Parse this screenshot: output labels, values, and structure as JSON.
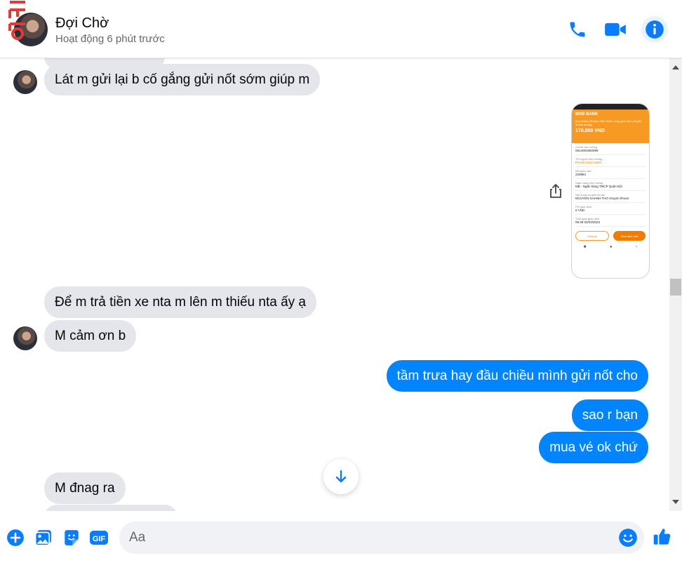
{
  "header": {
    "name": "Đợi Chờ",
    "status": "Hoạt động 6 phút trước",
    "corner_mark_text": "INFO"
  },
  "messages": [
    {
      "dir": "in",
      "text": "Lát m gửi lại b cố gắng gửi nốt sớm giúp m"
    },
    {
      "dir": "in",
      "text": "Để m trả tiền xe nta m lên m thiếu nta ấy ạ"
    },
    {
      "dir": "in",
      "text": "M cảm ơn b"
    },
    {
      "dir": "out",
      "text": "tầm trưa hay đầu chiều mình gửi nốt cho"
    },
    {
      "dir": "out",
      "text": "sao r bạn"
    },
    {
      "dir": "out",
      "text": "mua vé ok chứ"
    },
    {
      "dir": "in",
      "text": "M đnag ra"
    }
  ],
  "attachment": {
    "bank": "MSB BANK",
    "description": "Quý khách đã thực hiện thành công giao dịch chuyển nhanh tại đây",
    "amount": "170,000 VND",
    "rows": [
      {
        "label": "Số thẻ thụ hưởng",
        "value": "0814091992999"
      },
      {
        "label": "Tên người thụ hưởng",
        "value": "PHAM VAN HUNG",
        "highlight": true
      },
      {
        "label": "Mã giao dịch",
        "value": "229984"
      },
      {
        "label": "Ngân hàng thụ hưởng",
        "value": "MB - Ngân hàng TMCP Quân Đội"
      },
      {
        "label": "Nội dung chuyển khoản",
        "value": "NGUYEN KHANH THO chuyen khoan"
      },
      {
        "label": "Phí giao dịch",
        "value": "0 VND"
      },
      {
        "label": "Thời gian giao dịch",
        "value": "09:49 04/03/2023"
      }
    ],
    "btn_home": "Chia sẻ",
    "btn_new": "Giao dịch mới",
    "nav": [
      "■",
      "●",
      "‹"
    ]
  },
  "composer": {
    "placeholder": "Aa",
    "gif_label": "GIF"
  },
  "colors": {
    "messenger_blue": "#0084ff",
    "incoming_bubble": "#e4e6eb",
    "accent": "#0a7cff"
  }
}
